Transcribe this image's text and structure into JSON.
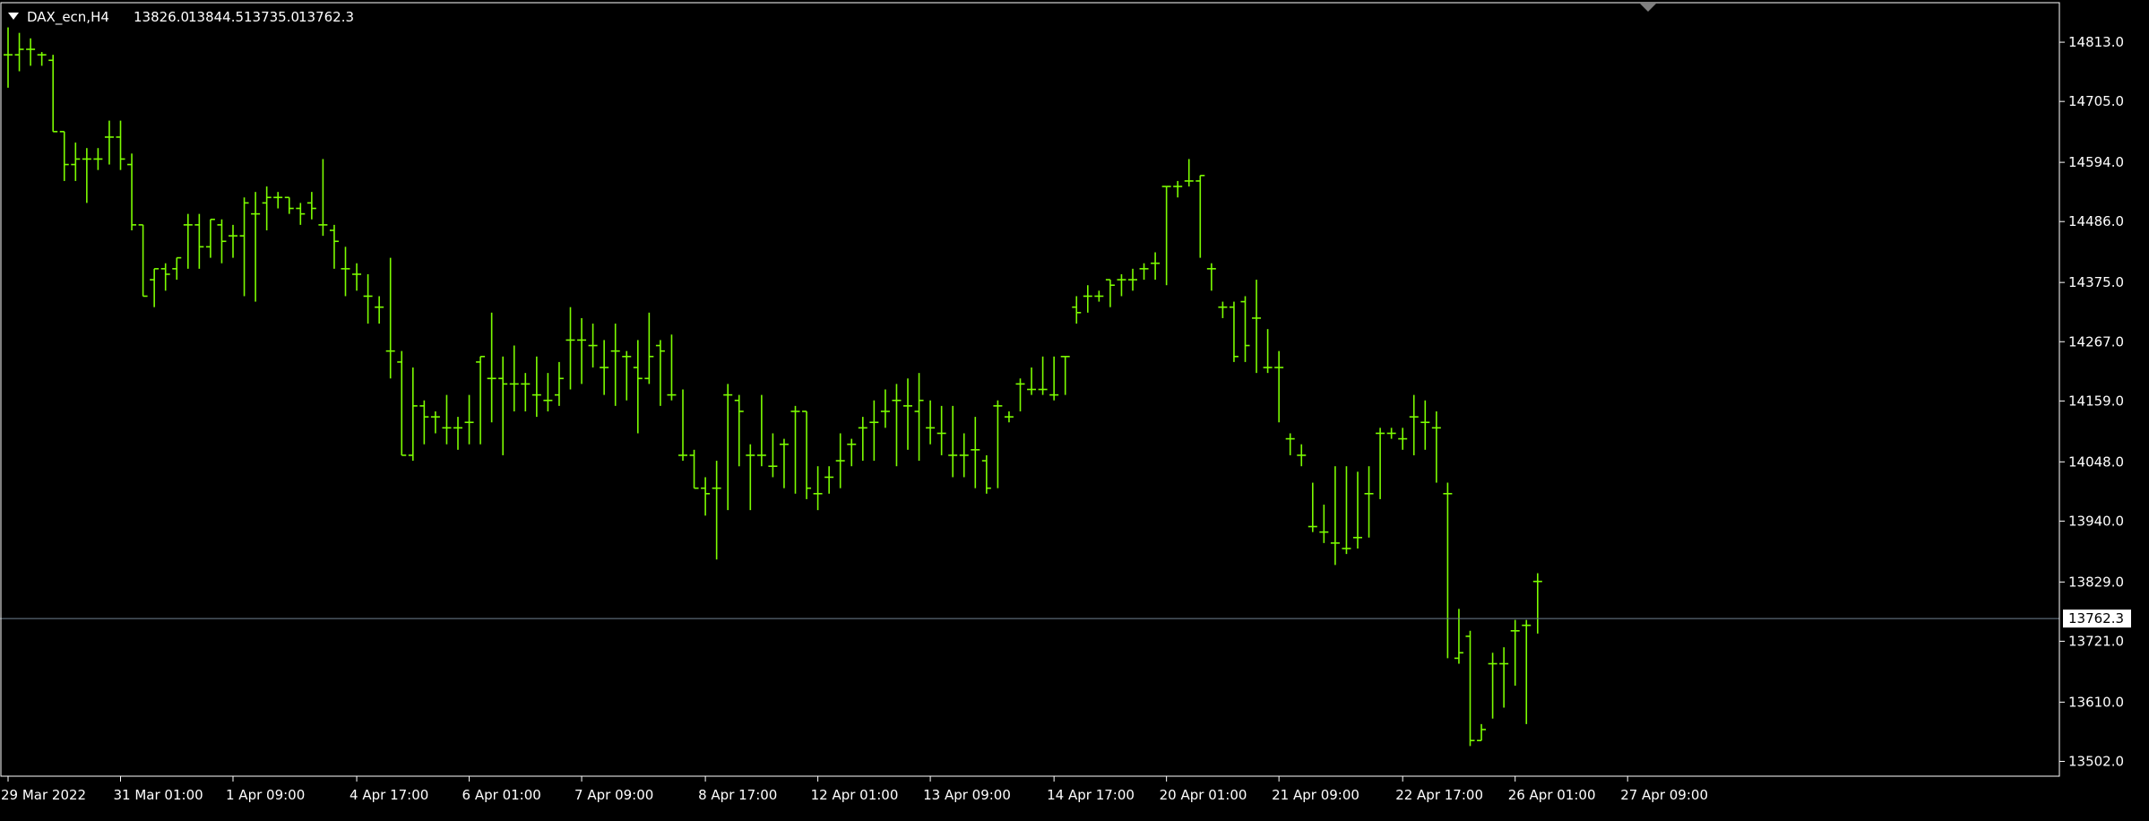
{
  "colors": {
    "background": "#000000",
    "bar": "#7CFC00",
    "axis": "#ffffff",
    "price_line": "#708090",
    "text": "#ffffff"
  },
  "chart_data": {
    "type": "ohlc",
    "title": "DAX_ecn,H4",
    "header": {
      "symbol": "DAX_ecn,H4",
      "open": "13826.0",
      "high": "13844.5",
      "low": "13735.0",
      "close": "13762.3"
    },
    "current_price": 13762.3,
    "current_price_label": "13762.3",
    "ylim": [
      13475,
      14885
    ],
    "y_ticks": [
      "14813.0",
      "14705.0",
      "14594.0",
      "14486.0",
      "14375.0",
      "14267.0",
      "14159.0",
      "14048.0",
      "13940.0",
      "13829.0",
      "13721.0",
      "13610.0",
      "13502.0"
    ],
    "x_tick_labels": [
      {
        "label": "29 Mar 2022",
        "bar": 0
      },
      {
        "label": "31 Mar 01:00",
        "bar": 10
      },
      {
        "label": "1 Apr 09:00",
        "bar": 20
      },
      {
        "label": "4 Apr 17:00",
        "bar": 31
      },
      {
        "label": "6 Apr 01:00",
        "bar": 41
      },
      {
        "label": "7 Apr 09:00",
        "bar": 51
      },
      {
        "label": "8 Apr 17:00",
        "bar": 62
      },
      {
        "label": "12 Apr 01:00",
        "bar": 72
      },
      {
        "label": "13 Apr 09:00",
        "bar": 82
      },
      {
        "label": "14 Apr 17:00",
        "bar": 93
      },
      {
        "label": "20 Apr 01:00",
        "bar": 103
      },
      {
        "label": "21 Apr 09:00",
        "bar": 113
      },
      {
        "label": "22 Apr 17:00",
        "bar": 124
      },
      {
        "label": "26 Apr 01:00",
        "bar": 134
      },
      {
        "label": "27 Apr 09:00",
        "bar": 144
      }
    ],
    "bars": [
      [
        14790,
        14840,
        14730,
        14790
      ],
      [
        14790,
        14830,
        14760,
        14800
      ],
      [
        14800,
        14820,
        14770,
        14800
      ],
      [
        14790,
        14795,
        14770,
        14790
      ],
      [
        14780,
        14790,
        14650,
        14650
      ],
      [
        14650,
        14650,
        14560,
        14590
      ],
      [
        14590,
        14630,
        14560,
        14600
      ],
      [
        14600,
        14620,
        14520,
        14600
      ],
      [
        14600,
        14620,
        14580,
        14600
      ],
      [
        14640,
        14670,
        14590,
        14640
      ],
      [
        14640,
        14670,
        14580,
        14600
      ],
      [
        14590,
        14610,
        14470,
        14480
      ],
      [
        14480,
        14480,
        14350,
        14350
      ],
      [
        14380,
        14400,
        14330,
        14400
      ],
      [
        14400,
        14410,
        14360,
        14390
      ],
      [
        14400,
        14420,
        14380,
        14420
      ],
      [
        14480,
        14500,
        14400,
        14480
      ],
      [
        14480,
        14500,
        14400,
        14440
      ],
      [
        14440,
        14490,
        14420,
        14490
      ],
      [
        14480,
        14490,
        14410,
        14450
      ],
      [
        14460,
        14480,
        14420,
        14460
      ],
      [
        14460,
        14530,
        14350,
        14520
      ],
      [
        14500,
        14540,
        14340,
        14500
      ],
      [
        14520,
        14550,
        14470,
        14530
      ],
      [
        14530,
        14540,
        14510,
        14530
      ],
      [
        14530,
        14530,
        14500,
        14510
      ],
      [
        14510,
        14520,
        14480,
        14500
      ],
      [
        14520,
        14540,
        14490,
        14510
      ],
      [
        14480,
        14600,
        14460,
        14480
      ],
      [
        14470,
        14480,
        14400,
        14450
      ],
      [
        14400,
        14440,
        14350,
        14400
      ],
      [
        14390,
        14410,
        14360,
        14390
      ],
      [
        14350,
        14390,
        14300,
        14350
      ],
      [
        14330,
        14350,
        14300,
        14330
      ],
      [
        14250,
        14420,
        14200,
        14250
      ],
      [
        14230,
        14250,
        14060,
        14060
      ],
      [
        14060,
        14220,
        14050,
        14150
      ],
      [
        14150,
        14160,
        14080,
        14130
      ],
      [
        14130,
        14140,
        14100,
        14130
      ],
      [
        14110,
        14170,
        14080,
        14110
      ],
      [
        14110,
        14130,
        14070,
        14110
      ],
      [
        14120,
        14170,
        14080,
        14120
      ],
      [
        14230,
        14240,
        14080,
        14240
      ],
      [
        14200,
        14320,
        14120,
        14200
      ],
      [
        14200,
        14240,
        14060,
        14190
      ],
      [
        14190,
        14260,
        14140,
        14190
      ],
      [
        14190,
        14210,
        14140,
        14190
      ],
      [
        14170,
        14240,
        14130,
        14170
      ],
      [
        14160,
        14210,
        14140,
        14160
      ],
      [
        14170,
        14230,
        14150,
        14200
      ],
      [
        14270,
        14330,
        14180,
        14270
      ],
      [
        14270,
        14310,
        14190,
        14270
      ],
      [
        14260,
        14300,
        14220,
        14260
      ],
      [
        14220,
        14270,
        14170,
        14220
      ],
      [
        14250,
        14300,
        14150,
        14250
      ],
      [
        14240,
        14250,
        14160,
        14240
      ],
      [
        14220,
        14270,
        14100,
        14200
      ],
      [
        14200,
        14320,
        14190,
        14240
      ],
      [
        14260,
        14270,
        14150,
        14250
      ],
      [
        14170,
        14280,
        14160,
        14170
      ],
      [
        14060,
        14180,
        14050,
        14060
      ],
      [
        14060,
        14070,
        14000,
        14000
      ],
      [
        14000,
        14020,
        13950,
        13990
      ],
      [
        14000,
        14050,
        13870,
        14000
      ],
      [
        14170,
        14190,
        13960,
        14170
      ],
      [
        14160,
        14170,
        14040,
        14140
      ],
      [
        14060,
        14080,
        13960,
        14060
      ],
      [
        14060,
        14170,
        14040,
        14060
      ],
      [
        14040,
        14100,
        14020,
        14040
      ],
      [
        14080,
        14090,
        14000,
        14080
      ],
      [
        14140,
        14150,
        13990,
        14140
      ],
      [
        14140,
        14140,
        13980,
        14000
      ],
      [
        13990,
        14040,
        13960,
        13990
      ],
      [
        14020,
        14040,
        13990,
        14020
      ],
      [
        14050,
        14100,
        14000,
        14050
      ],
      [
        14080,
        14090,
        14040,
        14080
      ],
      [
        14110,
        14130,
        14050,
        14110
      ],
      [
        14120,
        14160,
        14050,
        14120
      ],
      [
        14140,
        14180,
        14110,
        14140
      ],
      [
        14160,
        14190,
        14040,
        14160
      ],
      [
        14150,
        14200,
        14070,
        14150
      ],
      [
        14140,
        14210,
        14050,
        14160
      ],
      [
        14110,
        14160,
        14080,
        14110
      ],
      [
        14100,
        14150,
        14060,
        14100
      ],
      [
        14060,
        14150,
        14020,
        14060
      ],
      [
        14060,
        14100,
        14020,
        14060
      ],
      [
        14070,
        14130,
        14000,
        14070
      ],
      [
        14050,
        14060,
        13990,
        14000
      ],
      [
        14150,
        14160,
        14000,
        14150
      ],
      [
        14130,
        14140,
        14120,
        14130
      ],
      [
        14190,
        14200,
        14140,
        14190
      ],
      [
        14180,
        14220,
        14170,
        14180
      ],
      [
        14180,
        14240,
        14170,
        14180
      ],
      [
        14170,
        14240,
        14160,
        14170
      ],
      [
        14240,
        14240,
        14170,
        14240
      ],
      [
        14330,
        14350,
        14300,
        14320
      ],
      [
        14350,
        14370,
        14320,
        14350
      ],
      [
        14350,
        14360,
        14340,
        14350
      ],
      [
        14380,
        14380,
        14330,
        14370
      ],
      [
        14380,
        14390,
        14350,
        14380
      ],
      [
        14380,
        14400,
        14360,
        14380
      ],
      [
        14400,
        14410,
        14380,
        14400
      ],
      [
        14410,
        14430,
        14380,
        14410
      ],
      [
        14550,
        14550,
        14370,
        14550
      ],
      [
        14550,
        14560,
        14530,
        14550
      ],
      [
        14560,
        14600,
        14550,
        14560
      ],
      [
        14560,
        14570,
        14420,
        14570
      ],
      [
        14400,
        14410,
        14360,
        14400
      ],
      [
        14330,
        14340,
        14310,
        14330
      ],
      [
        14330,
        14340,
        14230,
        14240
      ],
      [
        14340,
        14350,
        14230,
        14260
      ],
      [
        14310,
        14380,
        14210,
        14310
      ],
      [
        14220,
        14290,
        14210,
        14220
      ],
      [
        14220,
        14250,
        14120,
        14220
      ],
      [
        14090,
        14100,
        14060,
        14090
      ],
      [
        14060,
        14080,
        14040,
        14060
      ],
      [
        13930,
        14010,
        13920,
        13930
      ],
      [
        13920,
        13970,
        13900,
        13920
      ],
      [
        13900,
        14040,
        13860,
        13900
      ],
      [
        13890,
        14040,
        13880,
        13890
      ],
      [
        13910,
        14030,
        13890,
        13910
      ],
      [
        13990,
        14040,
        13910,
        13990
      ],
      [
        14100,
        14110,
        13980,
        14100
      ],
      [
        14100,
        14110,
        14090,
        14100
      ],
      [
        14090,
        14110,
        14070,
        14090
      ],
      [
        14130,
        14170,
        14060,
        14130
      ],
      [
        14120,
        14160,
        14070,
        14120
      ],
      [
        14110,
        14140,
        14010,
        14110
      ],
      [
        13990,
        14010,
        13690,
        13990
      ],
      [
        13690,
        13780,
        13680,
        13700
      ],
      [
        13730,
        13740,
        13530,
        13540
      ],
      [
        13540,
        13570,
        13540,
        13560
      ],
      [
        13680,
        13700,
        13580,
        13680
      ],
      [
        13680,
        13710,
        13600,
        13680
      ],
      [
        13740,
        13760,
        13640,
        13740
      ],
      [
        13750,
        13760,
        13570,
        13750
      ],
      [
        13830,
        13845,
        13735,
        13830
      ]
    ]
  }
}
